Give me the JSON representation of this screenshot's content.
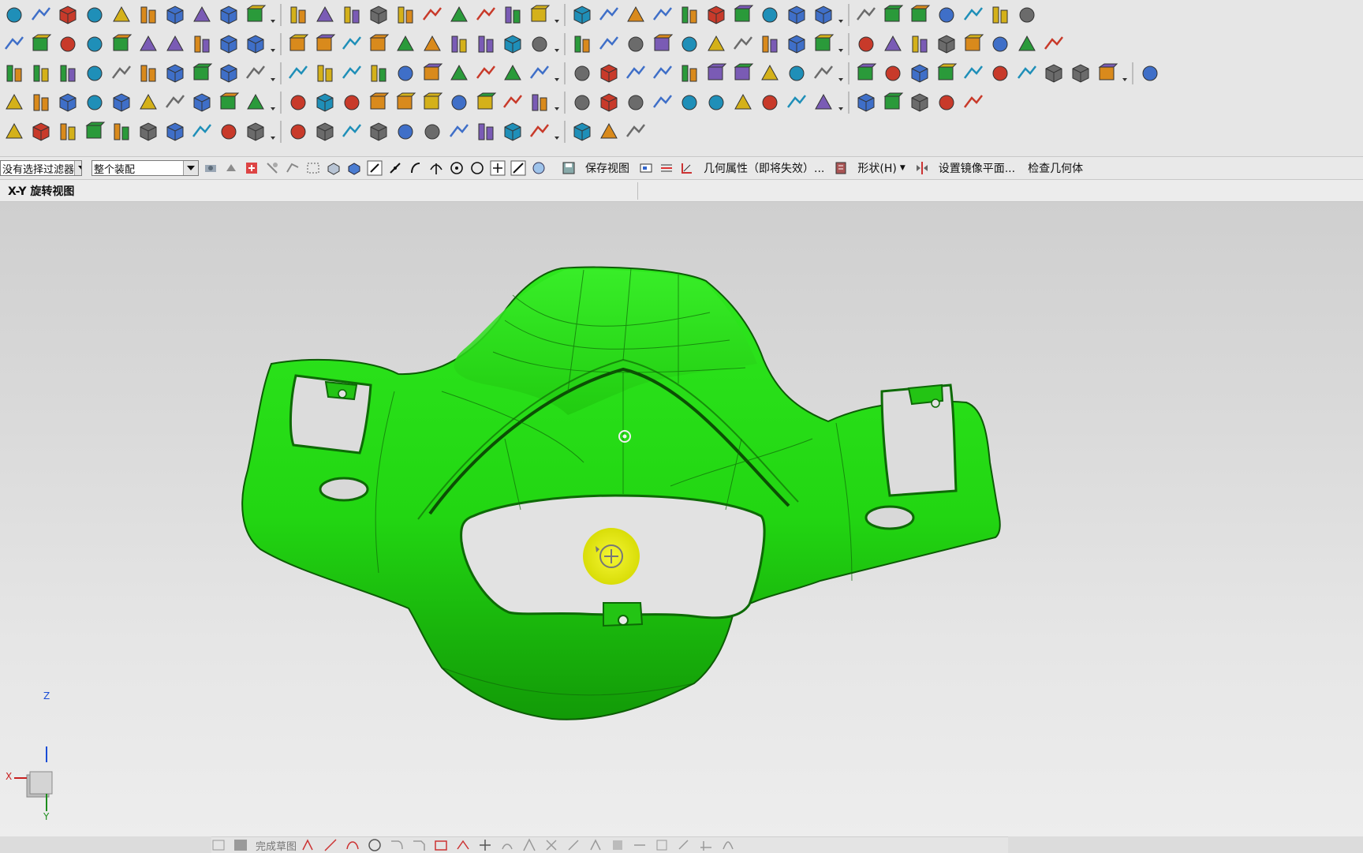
{
  "selection_bar": {
    "filter_value": "没有选择过滤器",
    "scope_value": "整个装配",
    "commands": [
      {
        "label": "保存视图"
      },
      {
        "label": "几何属性（即将失效）..."
      },
      {
        "label": "形状(H)"
      },
      {
        "label": "设置镜像平面..."
      },
      {
        "label": "检查几何体"
      }
    ]
  },
  "status": {
    "prompt": "X-Y 旋转视图"
  },
  "bottom_toolbar": {
    "finish_sketch_label": "完成草图"
  },
  "triad": {
    "x": "X",
    "y": "Y",
    "z": "Z"
  },
  "colors": {
    "model_green": "#1fd40e",
    "rotate_cursor": "#e8ec12",
    "toolbar_bg": "#e6e6e6"
  },
  "icons": {
    "row1": [
      "assembly-icon",
      "nx5-icon",
      "part-icon",
      "block-icon",
      "sheet-icon",
      "ribbon-icon",
      "sphere-icon",
      "cylinder-icon",
      "cube-icon",
      "cone-icon",
      "extrude-icon",
      "book-icon",
      "plate-icon",
      "solid-icon",
      "box-icon",
      "surface-icon",
      "sweep-icon",
      "panel-icon",
      "shell-icon",
      "hollow-icon",
      "tube-icon",
      "cabinet-icon",
      "prism-icon",
      "layer-icon",
      "stack-icon",
      "blend-icon",
      "green-solid-icon",
      "unite-icon",
      "subtract-icon",
      "measure-icon",
      "trim-icon",
      "divide-icon",
      "curve-icon",
      "sheet-metal-icon",
      "spline-icon",
      "offset-icon",
      "layer-settings-icon"
    ],
    "row2": [
      "snap-icon",
      "select-arrow-icon",
      "multi-select-icon",
      "group-icon",
      "component-icon",
      "datum-axis-icon",
      "dimension-icon",
      "grid-icon",
      "line-icon",
      "arc-icon",
      "rectangle-icon",
      "polyline-icon",
      "text-icon",
      "fillet-icon",
      "polygon-icon",
      "offset-curve-icon",
      "pattern-icon",
      "mirror-icon",
      "bridge-icon",
      "project-icon",
      "intersect-icon",
      "section-icon",
      "flag-icon",
      "surface1-icon",
      "surface2-icon",
      "surface3-icon",
      "surface4-icon",
      "surface5-icon",
      "surface6-icon",
      "surface7-icon",
      "surface8-icon",
      "surface9-icon",
      "surface10-icon",
      "surface11-icon",
      "surface12-icon",
      "surface13-icon",
      "surface14-icon",
      "surface15-icon"
    ],
    "row3": [
      "frame-icon",
      "mold-icon",
      "sun-icon",
      "stand-icon",
      "column-icon",
      "pillar-icon",
      "t-beam-icon",
      "target-icon",
      "post-icon",
      "t-icon",
      "spring-icon",
      "ladder-icon",
      "door-icon",
      "lock-icon",
      "cursor-icon",
      "pull-icon",
      "shaft-icon",
      "angle-icon",
      "pin-icon",
      "l-bracket-icon",
      "square-icon",
      "grid-cell-icon",
      "corner-icon",
      "ledge-icon",
      "wedge-icon",
      "h-beam-icon",
      "hatch-icon",
      "matrix-icon",
      "bolt-icon",
      "ruler-icon",
      "stripes-icon",
      "bracket-icon",
      "fork-icon",
      "tree-icon",
      "insert-icon",
      "cup-icon",
      "edit-icon",
      "check-icon",
      "list-icon",
      "gear-icon",
      "home-icon"
    ],
    "row4": [
      "cube-face-icon",
      "cube-solid-icon",
      "color-grid-icon",
      "brush-icon",
      "red-cube-icon",
      "crop-icon",
      "link-icon",
      "shape-icon",
      "split-icon",
      "column-split-icon",
      "axis-icon",
      "angle-measure-icon",
      "f8-icon",
      "x-axis-icon",
      "align-icon",
      "dimension2-icon",
      "hand-icon",
      "gear-box-icon",
      "wave-icon",
      "cup2-icon",
      "i-beam-icon",
      "arc-shape-icon",
      "move-icon",
      "flash-icon",
      "no-entry-icon",
      "compass-icon",
      "palette-icon",
      "orange-cube-icon",
      "orange-plate-icon",
      "white-cube-icon",
      "curve2-icon",
      "block2-icon",
      "text-label-icon",
      "coord-icon",
      "yellow-cubes-icon"
    ],
    "row5": [
      "move-part-icon",
      "parts-icon",
      "edit-part-icon",
      "close-part-icon",
      "chamfer-icon",
      "cross-chamfer-icon",
      "radius-icon",
      "text-note-icon",
      "layout-icon",
      "duplicate-icon",
      "flow-icon",
      "machine-icon",
      "copy-icon",
      "table-icon",
      "layers-icon",
      "dashed-line-icon",
      "dashed-line2-icon",
      "rotate-icon",
      "angle2-icon",
      "tab-icon",
      "spin-icon",
      "reduce-icon",
      "pattern-grid-icon"
    ]
  }
}
